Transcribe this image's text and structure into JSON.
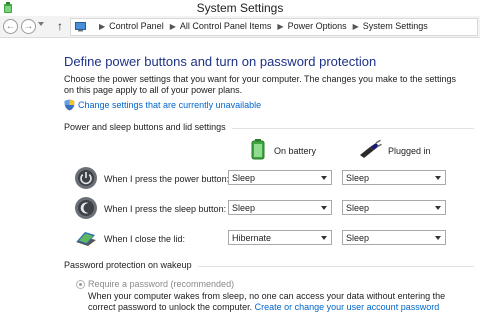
{
  "window": {
    "title": "System Settings"
  },
  "address": {
    "breadcrumbs": [
      "Control Panel",
      "All Control Panel Items",
      "Power Options",
      "System Settings"
    ]
  },
  "main": {
    "heading": "Define power buttons and turn on password protection",
    "description": "Choose the power settings that you want for your computer. The changes you make to the settings on this page apply to all of your power plans.",
    "change_link": "Change settings that are currently unavailable"
  },
  "power_section": {
    "label": "Power and sleep buttons and lid settings",
    "col_battery": "On battery",
    "col_plugged": "Plugged in",
    "rows": [
      {
        "label": "When I press the power button:",
        "battery": "Sleep",
        "plugged": "Sleep",
        "icon": "power-button-icon"
      },
      {
        "label": "When I press the sleep button:",
        "battery": "Sleep",
        "plugged": "Sleep",
        "icon": "sleep-button-icon"
      },
      {
        "label": "When I close the lid:",
        "battery": "Hibernate",
        "plugged": "Sleep",
        "icon": "laptop-lid-icon"
      }
    ]
  },
  "password_section": {
    "label": "Password protection on wakeup",
    "require_option": "Require a password (recommended)",
    "require_desc": "When your computer wakes from sleep, no one can access your data without entering the correct password to unlock the computer.",
    "password_link": "Create or change your user account password"
  },
  "colors": {
    "heading": "#1e3287",
    "link": "#0066cc",
    "disabled_text": "#8a8a8a"
  }
}
